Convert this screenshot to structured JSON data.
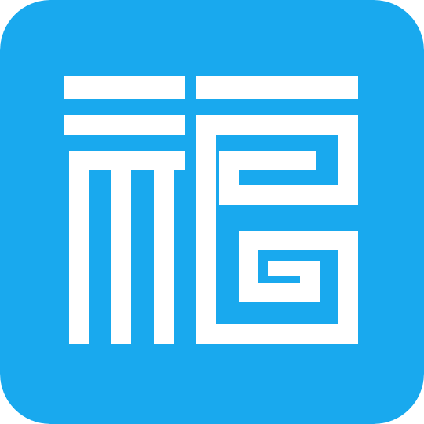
{
  "app_icon": {
    "glyph": "福",
    "background_color": "#19a9ee",
    "glyph_color": "#ffffff"
  }
}
